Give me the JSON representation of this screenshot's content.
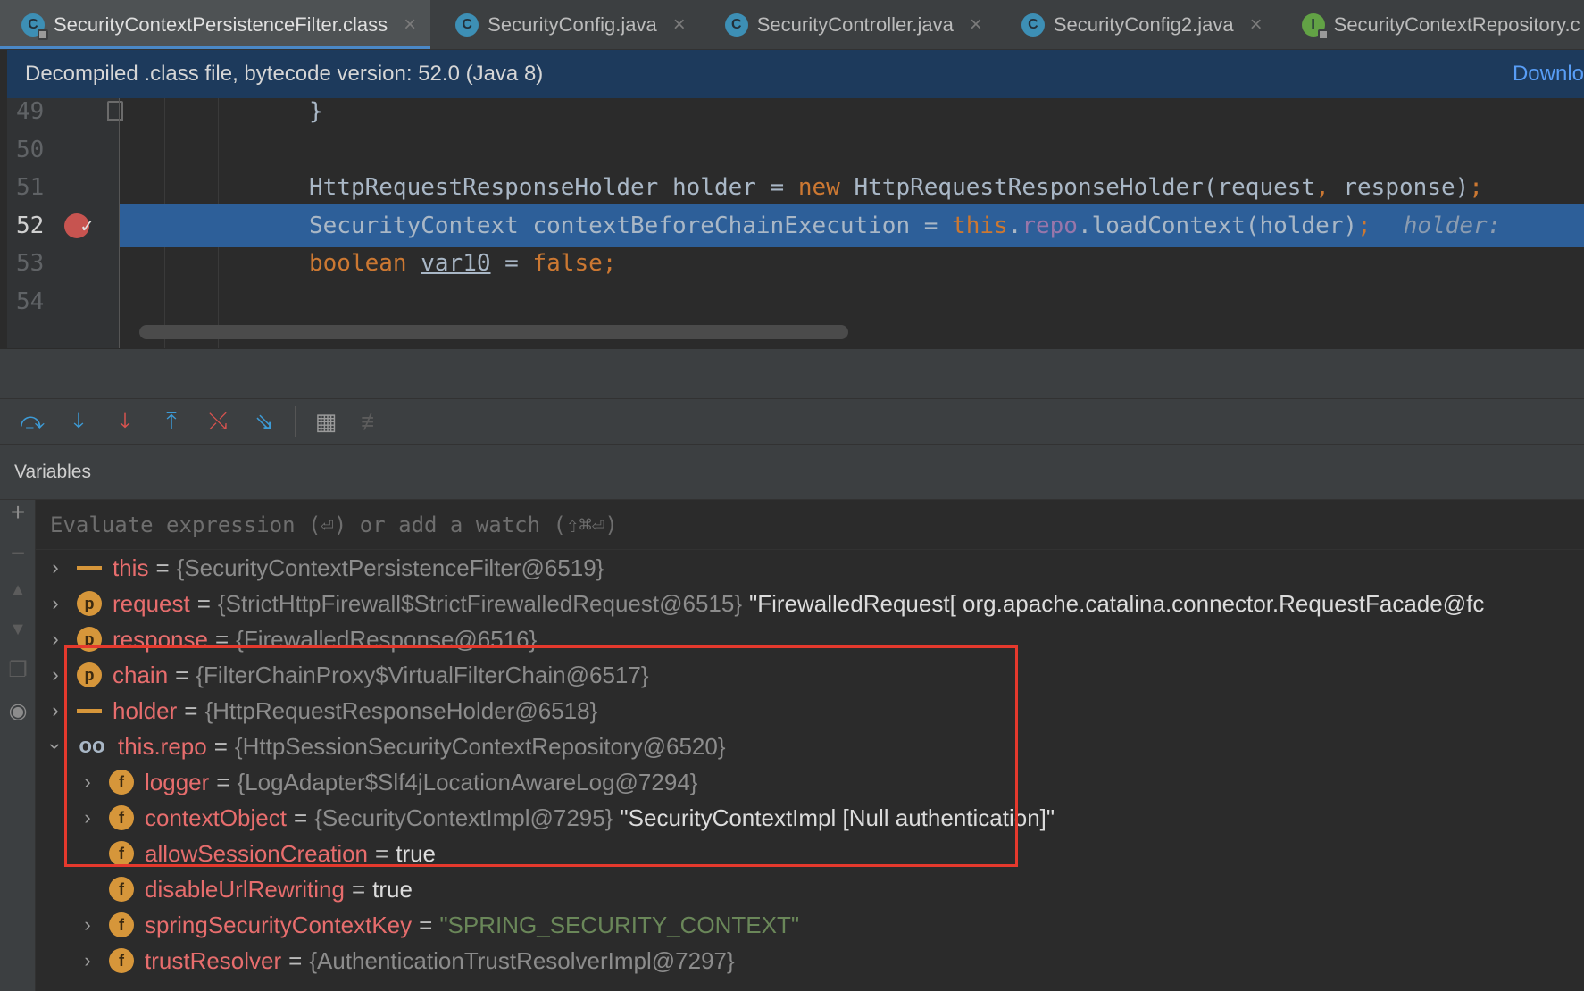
{
  "tabs": [
    {
      "label": "SecurityContextPersistenceFilter.class",
      "icon": "C",
      "active": true
    },
    {
      "label": "SecurityConfig.java",
      "icon": "C"
    },
    {
      "label": "SecurityController.java",
      "icon": "C"
    },
    {
      "label": "SecurityConfig2.java",
      "icon": "C"
    },
    {
      "label": "SecurityContextRepository.c",
      "icon": "I"
    }
  ],
  "tab_close": "×",
  "banner": {
    "text": "Decompiled .class file, bytecode version: 52.0 (Java 8)",
    "link": "Downlo"
  },
  "editor": {
    "lines": [
      {
        "num": "49",
        "code_a": "}"
      },
      {
        "num": "50"
      },
      {
        "num": "51",
        "t1": "HttpRequestResponseHolder holder = ",
        "kw": "new",
        "t2": " HttpRequestResponseHolder(request",
        "c": ",",
        "t3": " response)",
        "semi": ";"
      },
      {
        "num": "52",
        "t1": "SecurityContext contextBeforeChainExecution = ",
        "kw": "this",
        "dot": ".",
        "field": "repo",
        "t2": ".loadContext(holder)",
        "semi": ";",
        "hint": "holder:"
      },
      {
        "num": "53",
        "kw": "boolean",
        "sp": " ",
        "var": "var10",
        "t2": " = ",
        "kw2": "false",
        "semi": ";"
      },
      {
        "num": "54"
      }
    ]
  },
  "toolbar": {
    "icons": [
      "step-over-icon",
      "step-into-icon",
      "force-step-into-icon",
      "step-out-icon",
      "drop-frame-icon",
      "run-to-cursor-icon",
      "evaluate-icon",
      "trace-icon"
    ]
  },
  "variables": {
    "title": "Variables",
    "eval_placeholder": "Evaluate expression (⏎) or add a watch (⇧⌘⏎)",
    "rows": [
      {
        "name": "this",
        "type": "{SecurityContextPersistenceFilter@6519}",
        "extra": ""
      },
      {
        "name": "request",
        "type": "{StrictHttpFirewall$StrictFirewalledRequest@6515}",
        "extra": "\"FirewalledRequest[ org.apache.catalina.connector.RequestFacade@fc"
      },
      {
        "name": "response",
        "type": "{FirewalledResponse@6516}",
        "extra": ""
      },
      {
        "name": "chain",
        "type": "{FilterChainProxy$VirtualFilterChain@6517}",
        "extra": ""
      },
      {
        "name": "holder",
        "type": "{HttpRequestResponseHolder@6518}",
        "extra": ""
      },
      {
        "name": "this.repo",
        "type": "{HttpSessionSecurityContextRepository@6520}",
        "extra": ""
      },
      {
        "name": "logger",
        "type": "{LogAdapter$Slf4jLocationAwareLog@7294}",
        "extra": ""
      },
      {
        "name": "contextObject",
        "type": "{SecurityContextImpl@7295}",
        "extra": "\"SecurityContextImpl [Null authentication]\""
      },
      {
        "name": "allowSessionCreation",
        "value": "true"
      },
      {
        "name": "disableUrlRewriting",
        "value": "true"
      },
      {
        "name": "springSecurityContextKey",
        "value": "\"SPRING_SECURITY_CONTEXT\""
      },
      {
        "name": "trustResolver",
        "type": "{AuthenticationTrustResolverImpl@7297}",
        "extra": ""
      }
    ],
    "eq": "="
  },
  "icons": {
    "param": "p",
    "field": "f",
    "watch": "oo"
  },
  "colors": {
    "accent": "#4a88c7",
    "highlight": "#2d5f99",
    "var_name": "#e76d6d",
    "keyword": "#cc7832",
    "field": "#9876aa",
    "string": "#6a8759",
    "breakpoint": "#c75450",
    "annotation_box": "#e5392d"
  }
}
